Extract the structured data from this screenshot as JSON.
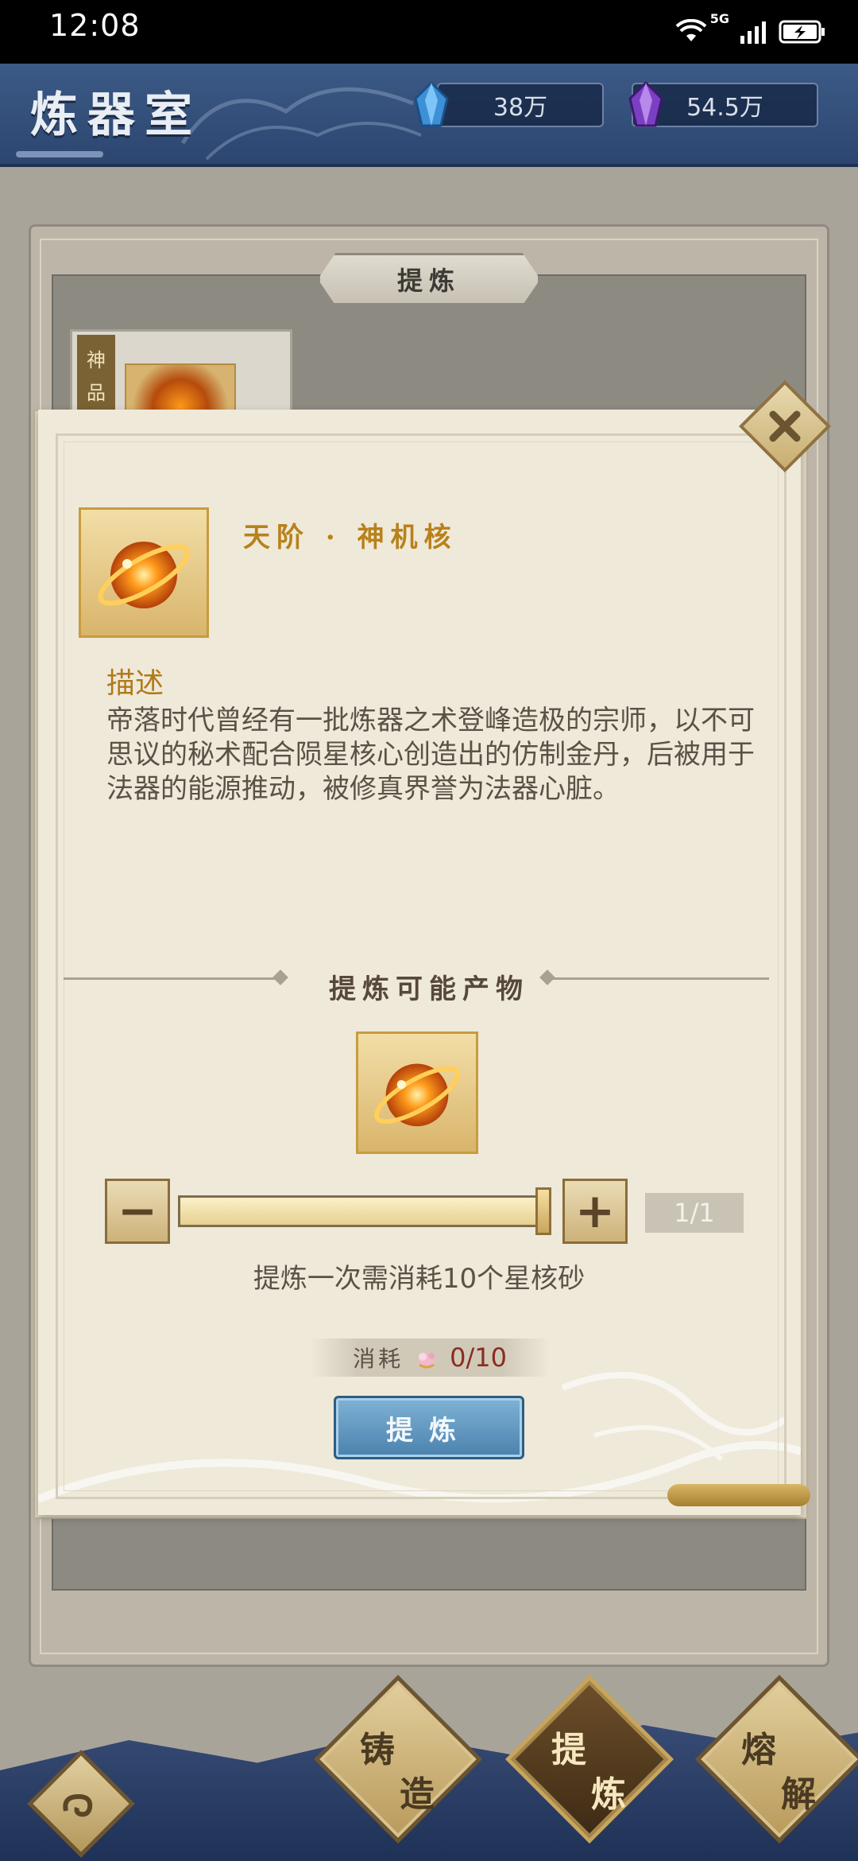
{
  "status_bar": {
    "time": "12:08",
    "network": "5G"
  },
  "header": {
    "title": "炼器室",
    "resource_blue": "38万",
    "resource_purple": "54.5万",
    "gem_blue_icon": "blue-crystal-icon",
    "gem_purple_icon": "purple-crystal-icon"
  },
  "panel": {
    "tab_title": "提炼",
    "card_tag": [
      "神",
      "品"
    ]
  },
  "popup": {
    "item_name": "天阶 · 神机核",
    "desc_label": "描述",
    "desc_text": "帝落时代曾经有一批炼器之术登峰造极的宗师，以不可思议的秘术配合陨星核心创造出的仿制金丹，后被用于法器的能源推动，被修真界誉为法器心脏。",
    "section_title": "提炼可能产物",
    "quantity": {
      "current": 1,
      "max": 1,
      "display": "1/1",
      "slider_fraction": 1.0
    },
    "minus_label": "−",
    "plus_label": "+",
    "cost_text": "提炼一次需消耗10个星核砂",
    "consume_label": "消耗",
    "consume_value": "0/10",
    "refine_button": "提炼"
  },
  "bottom_nav": {
    "forge": [
      "铸",
      "造"
    ],
    "refine": [
      "提",
      "炼"
    ],
    "smelt": [
      "熔",
      "解"
    ]
  },
  "colors": {
    "header_bg": "#3c5a86",
    "item_name": "#b8811a",
    "refine_button": "#5a90b9",
    "consume_value": "#8a2c20"
  }
}
